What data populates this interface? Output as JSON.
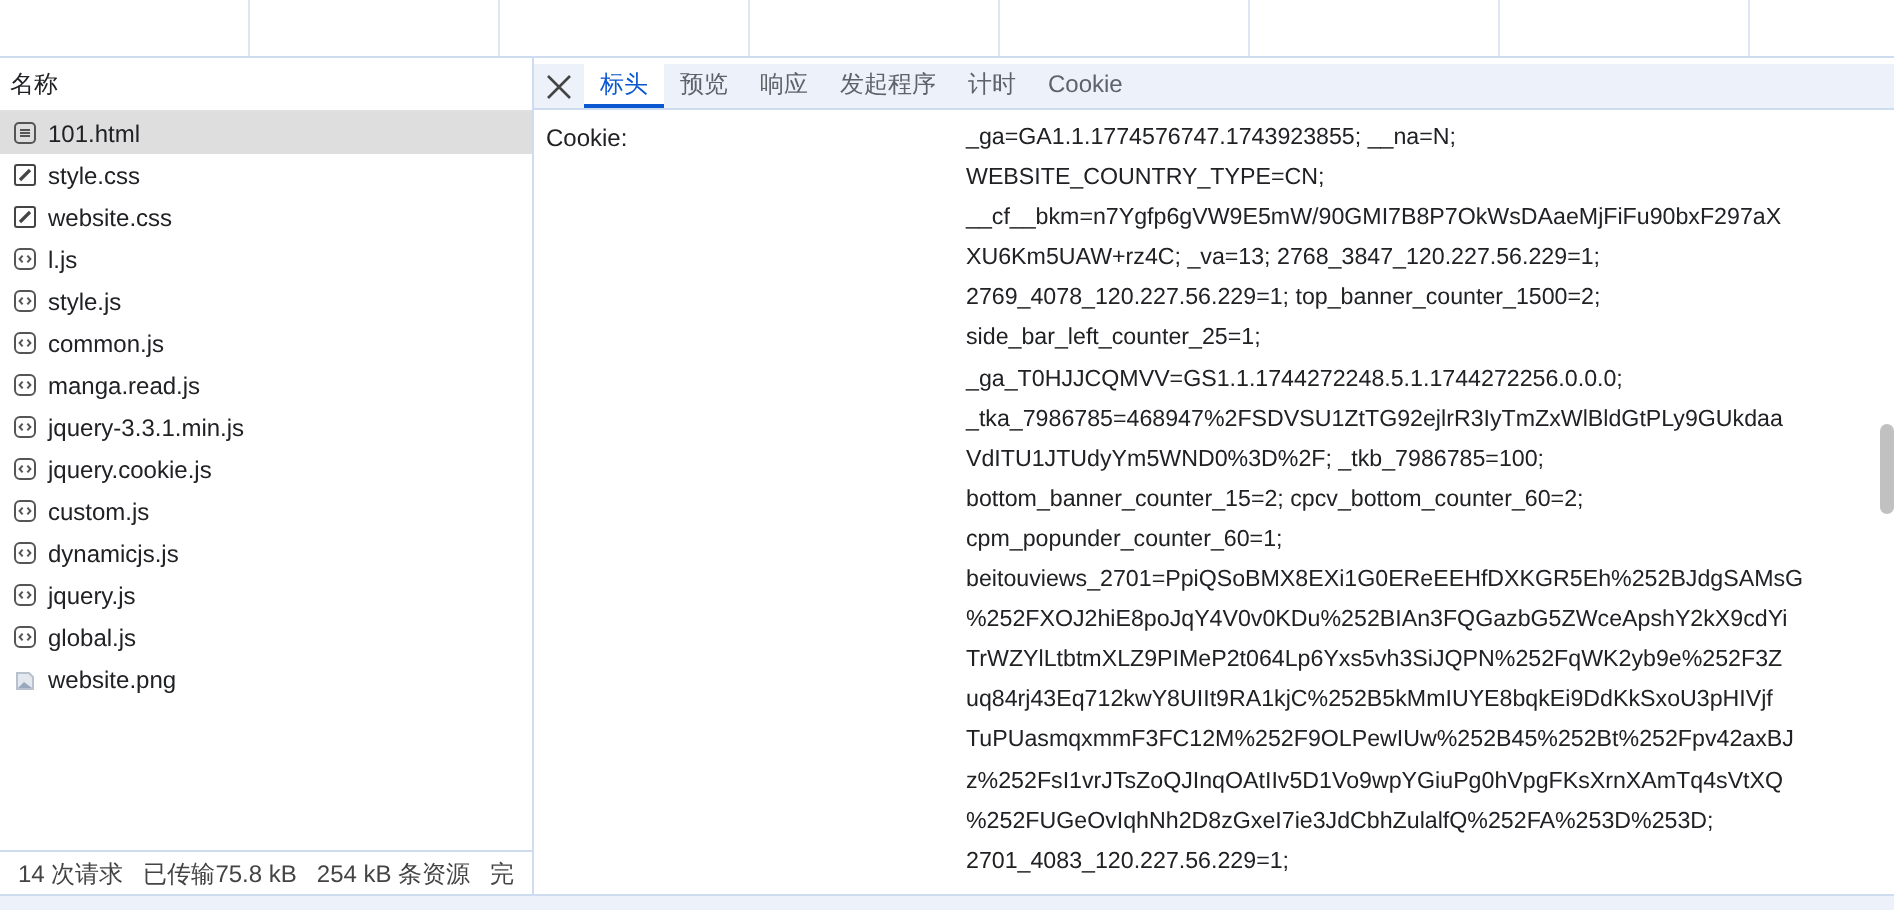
{
  "requests_header": {
    "label": "名称"
  },
  "requests": [
    {
      "name": "101.html",
      "kind": "document",
      "selected": true
    },
    {
      "name": "style.css",
      "kind": "stylesheet",
      "selected": false
    },
    {
      "name": "website.css",
      "kind": "stylesheet",
      "selected": false
    },
    {
      "name": "l.js",
      "kind": "script",
      "selected": false
    },
    {
      "name": "style.js",
      "kind": "script",
      "selected": false
    },
    {
      "name": "common.js",
      "kind": "script",
      "selected": false
    },
    {
      "name": "manga.read.js",
      "kind": "script",
      "selected": false
    },
    {
      "name": "jquery-3.3.1.min.js",
      "kind": "script",
      "selected": false
    },
    {
      "name": "jquery.cookie.js",
      "kind": "script",
      "selected": false
    },
    {
      "name": "custom.js",
      "kind": "script",
      "selected": false
    },
    {
      "name": "dynamicjs.js",
      "kind": "script",
      "selected": false
    },
    {
      "name": "jquery.js",
      "kind": "script",
      "selected": false
    },
    {
      "name": "global.js",
      "kind": "script",
      "selected": false
    },
    {
      "name": "website.png",
      "kind": "image",
      "selected": false
    }
  ],
  "status_bar": [
    "14 次请求",
    "已传输75.8 kB",
    "254 kB 条资源",
    "完"
  ],
  "tabs": [
    {
      "label": "标头",
      "selected": true
    },
    {
      "label": "预览",
      "selected": false
    },
    {
      "label": "响应",
      "selected": false
    },
    {
      "label": "发起程序",
      "selected": false
    },
    {
      "label": "计时",
      "selected": false
    },
    {
      "label": "Cookie",
      "selected": false
    }
  ],
  "headers": [
    {
      "name": "Cookie:",
      "value_lines": [
        "_ga=GA1.1.1774576747.1743923855; __na=N;",
        "WEBSITE_COUNTRY_TYPE=CN;",
        "__cf__bkm=n7Ygfp6gVW9E5mW/90GMI7B8P7OkWsDAaeMjFiFu90bxF297aX",
        "XU6Km5UAW+rz4C; _va=13; 2768_3847_120.227.56.229=1;",
        "2769_4078_120.227.56.229=1; top_banner_counter_1500=2;",
        "side_bar_left_counter_25=1;",
        "_ga_T0HJJCQMVV=GS1.1.1744272248.5.1.1744272256.0.0.0;",
        "_tka_7986785=468947%2FSDVSU1ZtTG92ejlrR3IyTmZxWlBldGtPLy9GUkdaa",
        "VdITU1JTUdyYm5WND0%3D%2F; _tkb_7986785=100;",
        "bottom_banner_counter_15=2; cpcv_bottom_counter_60=2;",
        "cpm_popunder_counter_60=1;",
        "beitouviews_2701=PpiQSoBMX8EXi1G0EReEEHfDXKGR5Eh%252BJdgSAMsG",
        "%252FXOJ2hiE8poJqY4V0v0KDu%252BIAn3FQGazbG5ZWceApshY2kX9cdYi",
        "TrWZYlLtbtmXLZ9PIMeP2t064Lp6Yxs5vh3SiJQPN%252FqWK2yb9e%252F3Z",
        "uq84rj43Eq712kwY8UIIt9RA1kjC%252B5kMmIUYE8bqkEi9DdKkSxoU3pHIVjf",
        "TuPUasmqxmmF3FC12M%252F9OLPewIUw%252B45%252Bt%252Fpv42axBJ",
        "z%252FsI1vrJTsZoQJInqOAtIIv5D1Vo9wpYGiuPg0hVpgFKsXrnXAmTq4sVtXQ",
        "%252FUGeOvIqhNh2D8zGxeI7ie3JdCbhZulalfQ%252FA%253D%253D;",
        "2701_4083_120.227.56.229=1;"
      ]
    }
  ]
}
